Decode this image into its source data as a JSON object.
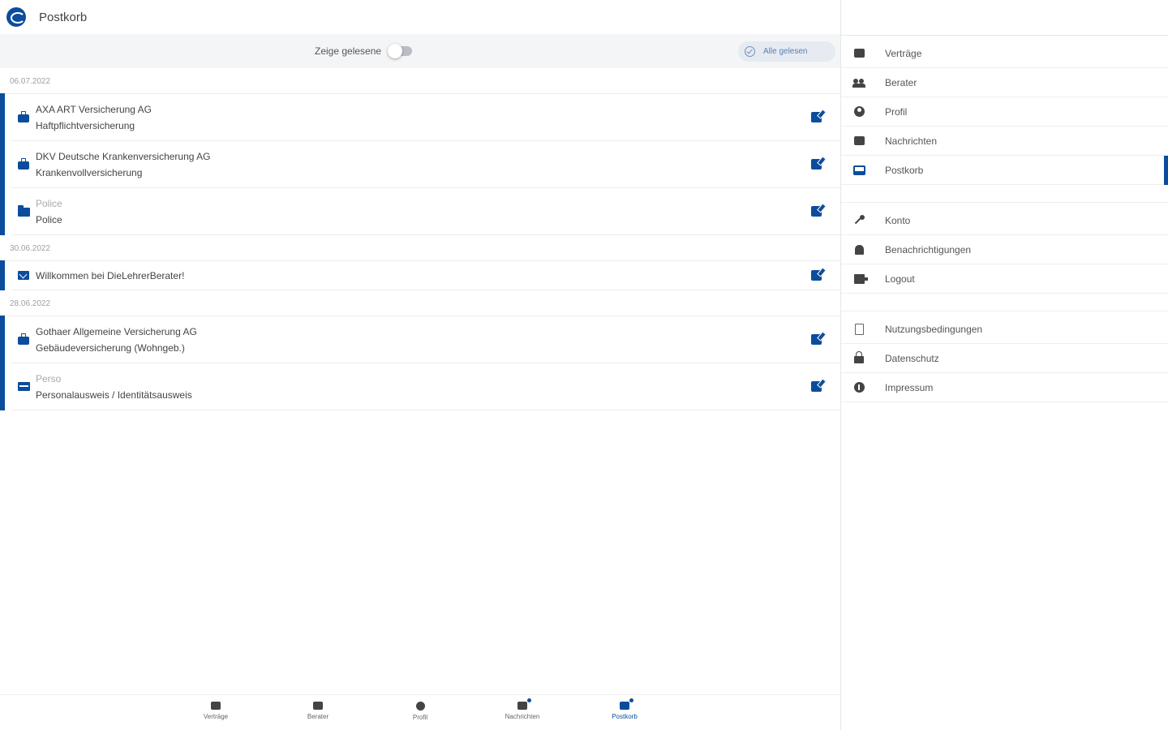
{
  "header": {
    "title": "Postkorb"
  },
  "filter": {
    "show_read_label": "Zeige gelesene",
    "all_read_label": "Alle gelesen"
  },
  "groups": [
    {
      "date": "06.07.2022",
      "items": [
        {
          "line1": "AXA ART Versicherung AG",
          "line2": "Haftpflichtversicherung"
        },
        {
          "line1": "DKV Deutsche Krankenversicherung AG",
          "line2": "Krankenvollversicherung"
        },
        {
          "line1": "Police",
          "line2": "Police"
        }
      ]
    },
    {
      "date": "30.06.2022",
      "items": [
        {
          "line1": "Willkommen bei DieLehrerBerater!"
        }
      ]
    },
    {
      "date": "28.06.2022",
      "items": [
        {
          "line1": "Gothaer Allgemeine Versicherung AG",
          "line2": "Gebäudeversicherung (Wohngeb.)"
        },
        {
          "line1": "Perso",
          "line2": "Personalausweis / Identitätsausweis"
        }
      ]
    }
  ],
  "sidenav": {
    "group1": [
      "Verträge",
      "Berater",
      "Profil",
      "Nachrichten",
      "Postkorb"
    ],
    "group2": [
      "Konto",
      "Benachrichtigungen",
      "Logout"
    ],
    "group3": [
      "Nutzungsbedingungen",
      "Datenschutz",
      "Impressum"
    ]
  },
  "tabbar": [
    "Verträge",
    "Berater",
    "Profil",
    "Nachrichten",
    "Postkorb"
  ],
  "colors": {
    "accent": "#0b4d9c"
  }
}
